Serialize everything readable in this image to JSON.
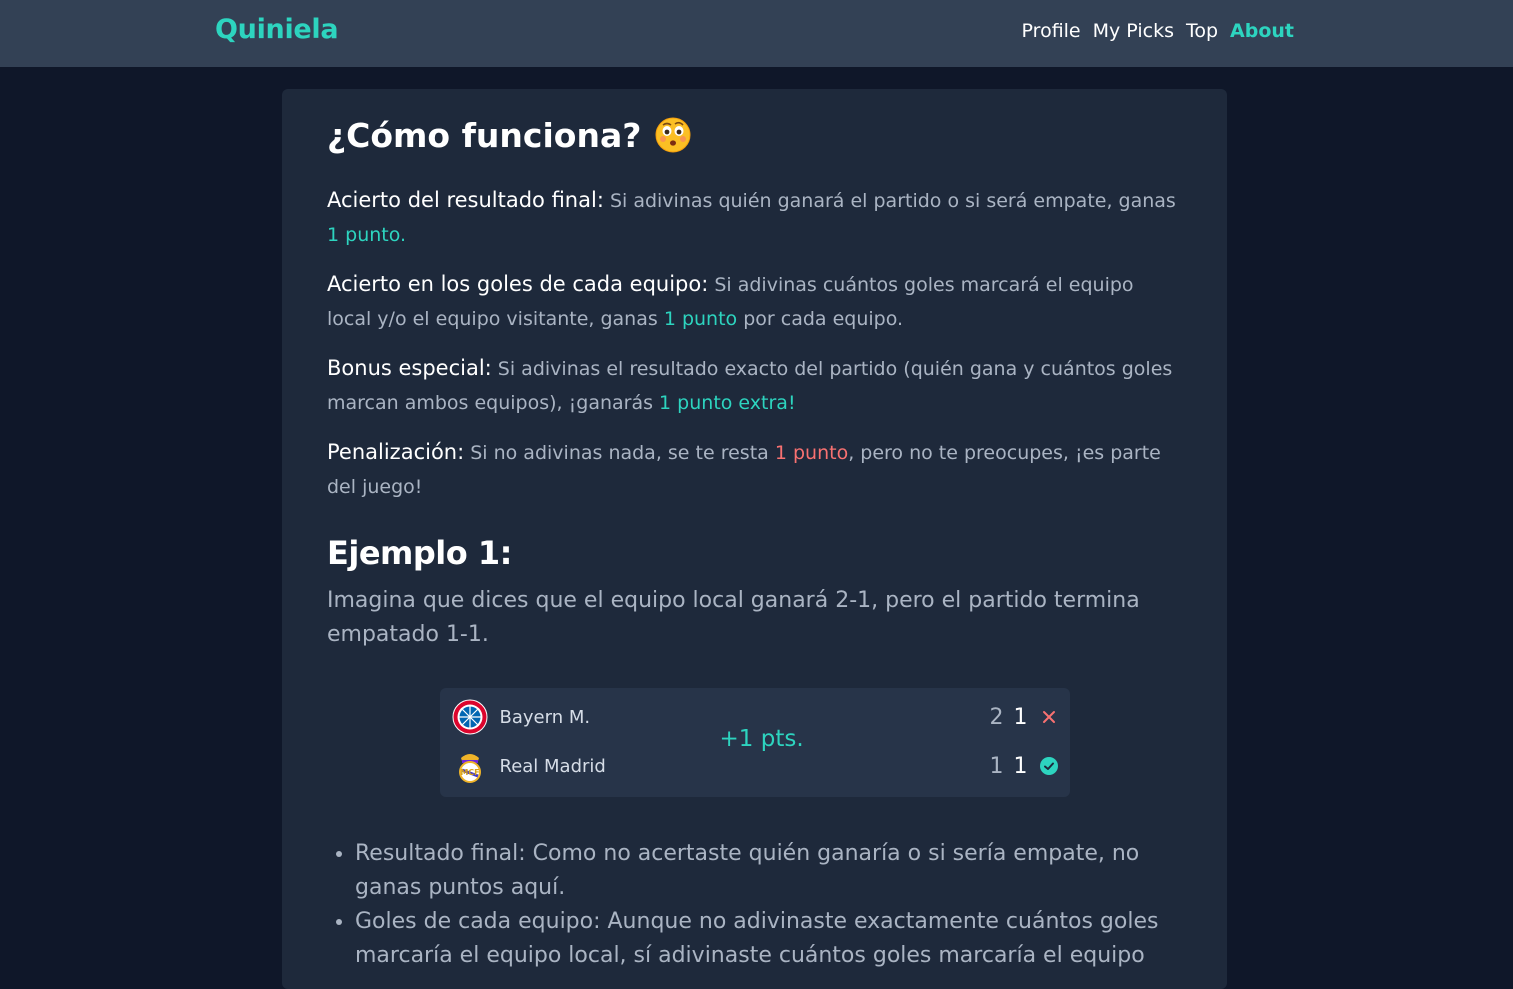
{
  "navbar": {
    "brand": "Quiniela",
    "links": [
      "Profile",
      "My Picks",
      "Top",
      "About"
    ],
    "active": "About"
  },
  "about": {
    "title": "¿Cómo funciona?",
    "title_icon": "thinking-face-emoji",
    "rules": [
      {
        "lead": "Acierto del resultado final:",
        "text_before": " Si adivinas quién ganará el partido o si será empate, ganas ",
        "highlight": "1 punto",
        "text_after": "."
      },
      {
        "lead": "Acierto en los goles de cada equipo:",
        "text_before": " Si adivinas cuántos goles marcará el equipo local y/o el equipo visitante, ganas ",
        "highlight": "1 punto",
        "text_after": " por cada equipo."
      },
      {
        "lead": "Bonus especial:",
        "text_before": " Si adivinas el resultado exacto del partido (quién gana y cuántos goles marcan ambos equipos), ¡ganarás ",
        "highlight": "1 punto extra",
        "text_after": "!"
      },
      {
        "lead": "Penalización:",
        "text_before": " Si no adivinas nada, se te resta ",
        "highlight": "1 punto",
        "text_after": ", pero no te preocupes, ¡es parte del juego!"
      }
    ],
    "example": {
      "title": "Ejemplo 1:",
      "text": "Imagina que dices que el equipo local ganará 2-1, pero el partido termina empatado 1-1.",
      "match": {
        "home": {
          "name": "Bayern M.",
          "predicted": "2",
          "actual": "1",
          "status": "wrong",
          "crest": "bayern-crest-icon"
        },
        "away": {
          "name": "Real Madrid",
          "predicted": "1",
          "actual": "1",
          "status": "correct",
          "crest": "real-madrid-crest-icon"
        },
        "points": "+1 pts."
      },
      "bullets": [
        "Resultado final: Como no acertaste quién ganaría o si sería empate, no ganas puntos aquí.",
        "Goles de cada equipo: Aunque no adivinaste exactamente cuántos goles marcaría el equipo local, sí adivinaste cuántos goles marcaría el equipo"
      ]
    }
  },
  "colors": {
    "accent": "#2dd4bf",
    "penalty": "#f87171",
    "background": "#0f1729",
    "card": "#1e293b",
    "navbar": "#334155"
  }
}
